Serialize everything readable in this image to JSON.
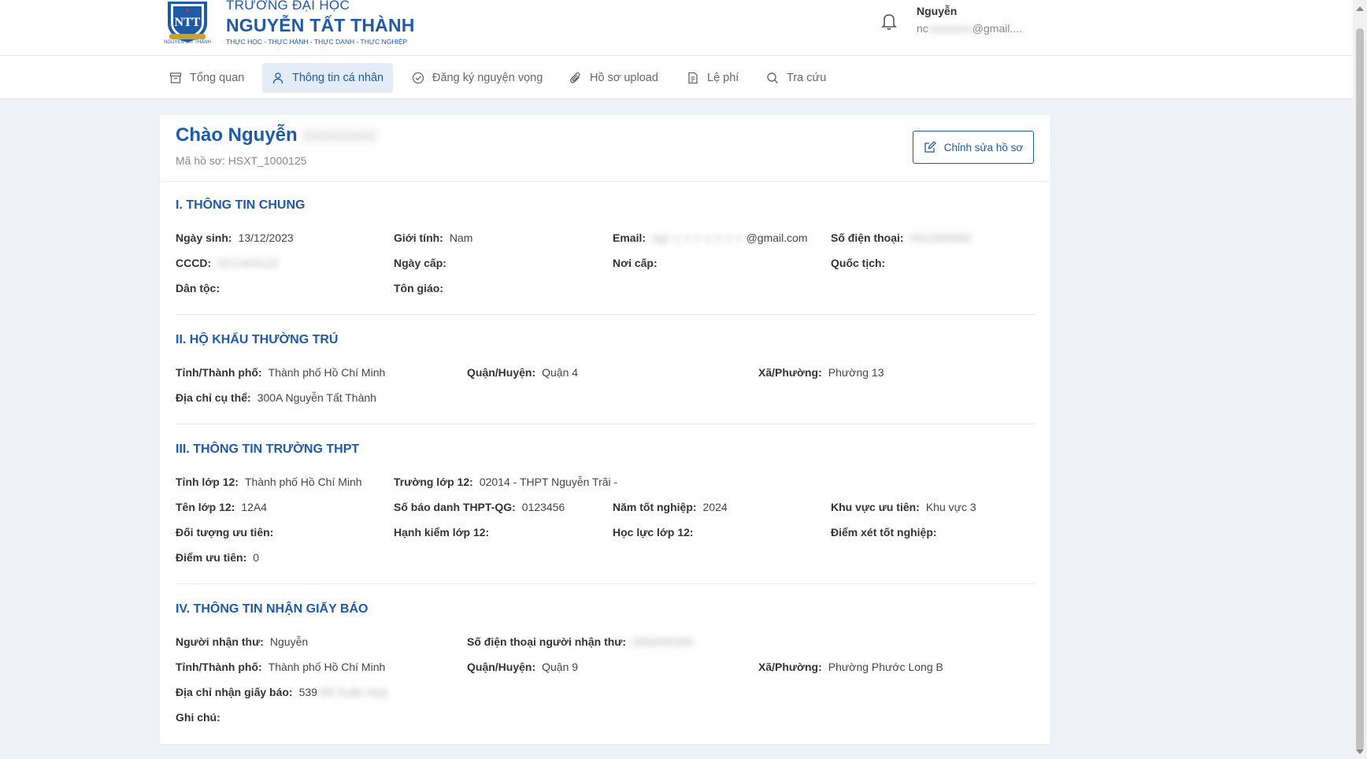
{
  "header": {
    "logo_line1": "TRƯỜNG ĐẠI HỌC",
    "logo_line2": "NGUYỄN TẤT THÀNH",
    "logo_line3": "THỰC HỌC - THỰC HÀNH - THỰC DANH - THỰC NGHIỆP",
    "logo_seal_text": "NGUYEN TAT THANH",
    "user_name": "Nguyễn",
    "user_email_prefix": "nc",
    "user_email_suffix": "@gmail...."
  },
  "nav": {
    "items": [
      {
        "label": "Tổng quan",
        "icon": "archive-icon"
      },
      {
        "label": "Thông tin cá nhân",
        "icon": "user-icon"
      },
      {
        "label": "Đăng ký nguyện vọng",
        "icon": "check-circle-icon"
      },
      {
        "label": "Hồ sơ upload",
        "icon": "paperclip-icon"
      },
      {
        "label": "Lệ phí",
        "icon": "document-icon"
      },
      {
        "label": "Tra cứu",
        "icon": "search-icon"
      }
    ],
    "active_index": 1
  },
  "profile": {
    "greeting": "Chào Nguyễn",
    "record_code": "Mã hồ sơ: HSXT_1000125",
    "edit_button": "Chỉnh sửa hồ sơ"
  },
  "section1": {
    "title": "I. THÔNG TIN CHUNG",
    "dob_label": "Ngày sinh:",
    "dob": "13/12/2023",
    "gender_label": "Giới tính:",
    "gender": "Nam",
    "email_label": "Email:",
    "email": "@gmail.com",
    "phone_label": "Số điện thoại:",
    "phone": "0912000000",
    "cccd_label": "CCCD:",
    "cccd": "0211403123",
    "issue_date_label": "Ngày cấp:",
    "issue_place_label": "Nơi cấp:",
    "nationality_label": "Quốc tịch:",
    "ethnicity_label": "Dân tộc:",
    "religion_label": "Tôn giáo:"
  },
  "section2": {
    "title": "II. HỘ KHẨU THƯỜNG TRÚ",
    "province_label": "Tỉnh/Thành phố:",
    "province": "Thành phố Hồ Chí Minh",
    "district_label": "Quận/Huyện:",
    "district": "Quận 4",
    "ward_label": "Xã/Phường:",
    "ward": "Phường 13",
    "address_label": "Địa chỉ cụ thể:",
    "address": "300A Nguyễn Tất Thành"
  },
  "section3": {
    "title": "III. THÔNG TIN TRƯỜNG THPT",
    "g12_province_label": "Tỉnh lớp 12:",
    "g12_province": "Thành phố Hồ Chí Minh",
    "g12_school_label": "Trường lớp 12:",
    "g12_school": "02014 - THPT Nguyễn Trãi -",
    "class_label": "Tên lớp 12:",
    "class": "12A4",
    "exam_id_label": "Số báo danh THPT-QG:",
    "exam_id": "0123456",
    "grad_year_label": "Năm tốt nghiệp:",
    "grad_year": "2024",
    "priority_area_label": "Khu vực ưu tiên:",
    "priority_area": "Khu vực 3",
    "priority_group_label": "Đối tượng ưu tiên:",
    "conduct_label": "Hạnh kiểm lớp 12:",
    "academic_label": "Học lực lớp 12:",
    "grad_score_label": "Điểm xét tốt nghiệp:",
    "bonus_label": "Điểm ưu tiên:",
    "bonus": "0"
  },
  "section4": {
    "title": "IV. THÔNG TIN NHẬN GIẤY BÁO",
    "recipient_label": "Người nhận thư:",
    "recipient": "Nguyễn",
    "recipient_phone_label": "Số điện thoại người nhận thư:",
    "recipient_phone": "0900000300",
    "province_label": "Tỉnh/Thành phố:",
    "province": "Thành phố Hồ Chí Minh",
    "district_label": "Quận/Huyện:",
    "district": "Quận 9",
    "ward_label": "Xã/Phường:",
    "ward": "Phường Phước Long B",
    "address_label": "Địa chỉ nhận giấy báo:",
    "address_prefix": "539",
    "address_rest": "Đỗ Xuân Hợp",
    "note_label": "Ghi chú:"
  }
}
